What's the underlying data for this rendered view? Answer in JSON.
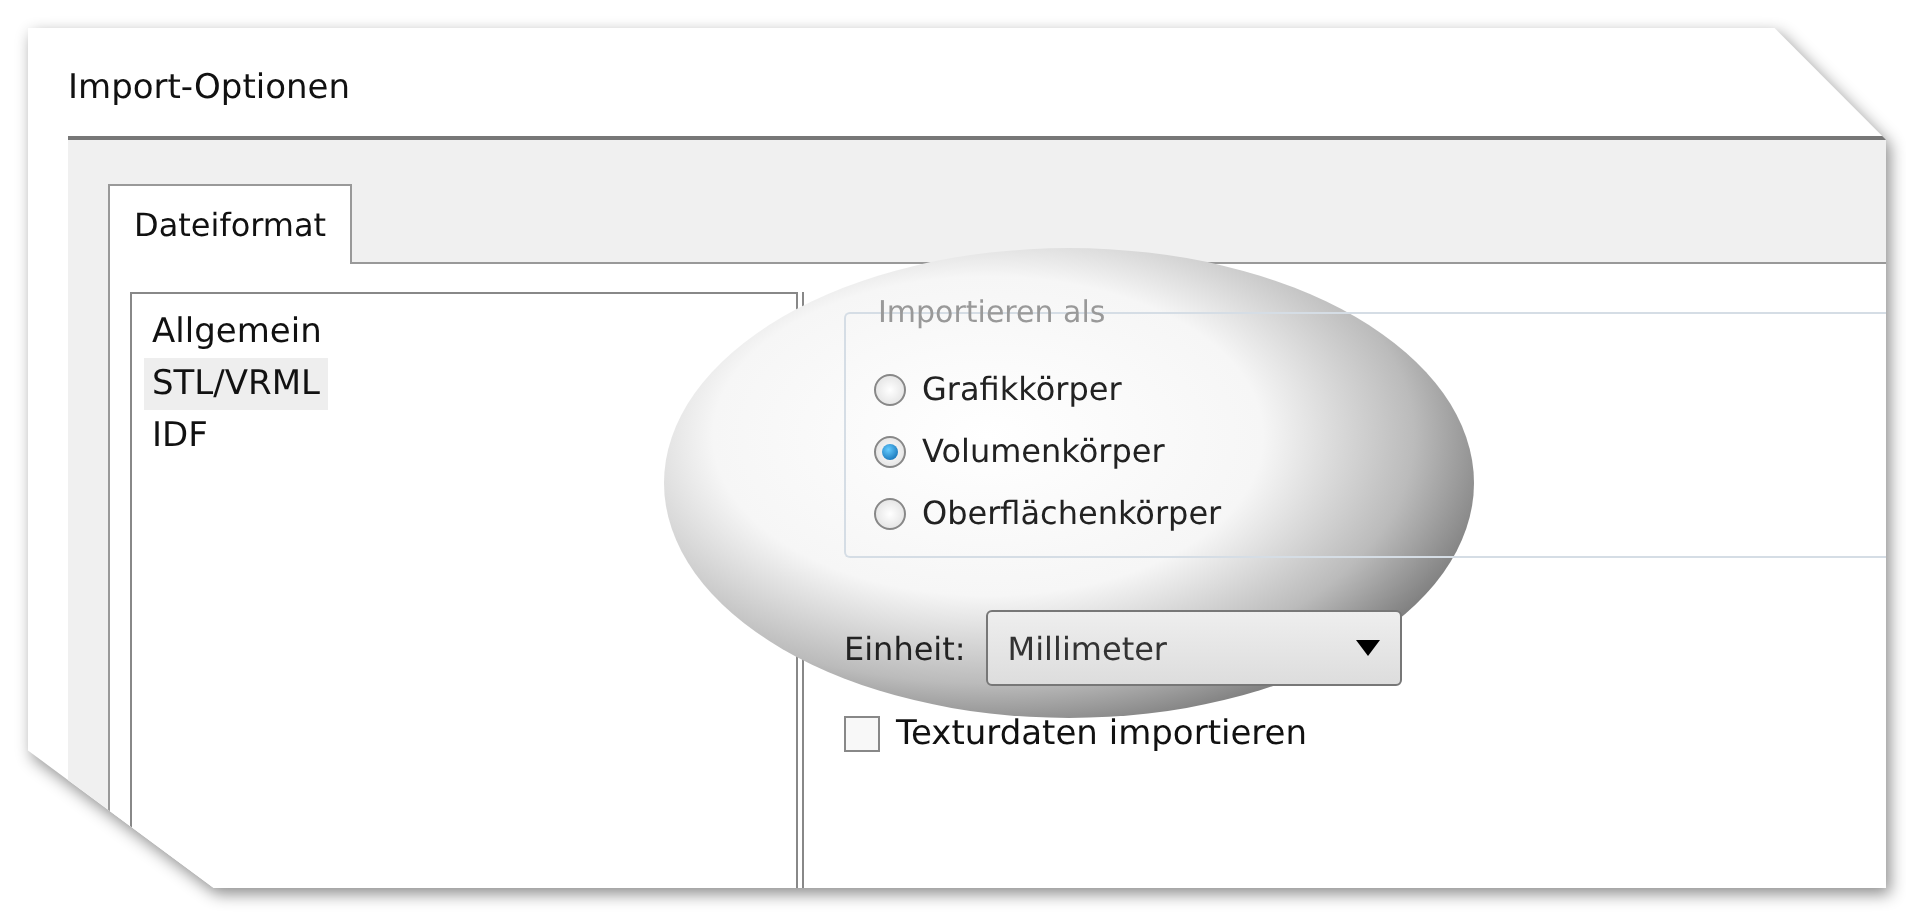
{
  "window": {
    "title": "Import-Optionen"
  },
  "tabs": [
    {
      "label": "Dateiformat",
      "selected": true
    }
  ],
  "categories": [
    {
      "label": "Allgemein",
      "selected": false
    },
    {
      "label": "STL/VRML",
      "selected": true
    },
    {
      "label": "IDF",
      "selected": false
    }
  ],
  "import_as": {
    "title": "Importieren als",
    "options": [
      {
        "label": "Grafikkörper",
        "selected": false
      },
      {
        "label": "Volumenkörper",
        "selected": true
      },
      {
        "label": "Oberflächenkörper",
        "selected": false
      }
    ]
  },
  "unit": {
    "label": "Einheit:",
    "value": "Millimeter"
  },
  "texture": {
    "label": "Texturdaten importieren",
    "checked": false
  }
}
